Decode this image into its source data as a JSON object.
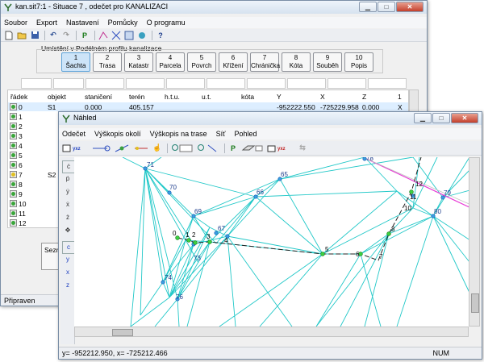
{
  "main_window": {
    "title": "kan.sit7:1 - Situace 7 , odečet pro KANALIZACI",
    "menu": [
      "Soubor",
      "Export",
      "Nastavení",
      "Pomůcky",
      "O programu"
    ],
    "group_label": "Umístění v Podélném profilu kanalizace",
    "tabs": [
      {
        "num": "1",
        "label": "Šachta"
      },
      {
        "num": "2",
        "label": "Trasa"
      },
      {
        "num": "3",
        "label": "Katastr"
      },
      {
        "num": "4",
        "label": "Parcela"
      },
      {
        "num": "5",
        "label": "Povrch"
      },
      {
        "num": "6",
        "label": "Křížení"
      },
      {
        "num": "7",
        "label": "Chránička"
      },
      {
        "num": "8",
        "label": "Kóta"
      },
      {
        "num": "9",
        "label": "Souběh"
      },
      {
        "num": "10",
        "label": "Popis"
      }
    ],
    "columns": [
      "řádek",
      "objekt",
      "staničení",
      "terén",
      "h.t.u.",
      "u.t.",
      "kóta",
      "Y",
      "X",
      "Z",
      "1"
    ],
    "first_row": {
      "row": "0",
      "objekt": "S1",
      "stanice": "0.000",
      "teren": "405.157",
      "Y": "-952222.550",
      "X": "-725229.958",
      "Z": "0.000",
      "extra": "X"
    },
    "row_numbers": [
      "0",
      "1",
      "2",
      "3",
      "4",
      "5",
      "6",
      "7",
      "8",
      "9",
      "10",
      "11",
      "12"
    ],
    "row7_object": "S2",
    "side_button": "Sezn",
    "status": "Připraven"
  },
  "preview_window": {
    "title": "Náhled",
    "menu": [
      "Odečet",
      "Výškopis okolí",
      "Výškopis na trase",
      "Síť",
      "Pohled"
    ],
    "coords": "y= -952212.950, x= -725212.466",
    "num": "NUM"
  },
  "map": {
    "point_labels": [
      {
        "t": "71"
      },
      {
        "t": "70"
      },
      {
        "t": "65"
      },
      {
        "t": "66"
      },
      {
        "t": "69"
      },
      {
        "t": "67"
      },
      {
        "t": "73"
      },
      {
        "t": "74"
      },
      {
        "t": "76"
      },
      {
        "t": "0"
      },
      {
        "t": "1"
      },
      {
        "t": "2"
      },
      {
        "t": "3"
      },
      {
        "t": "4"
      },
      {
        "t": "5"
      },
      {
        "t": "6"
      },
      {
        "t": "7"
      },
      {
        "t": "8"
      },
      {
        "t": "10"
      },
      {
        "t": "11"
      },
      {
        "t": "12"
      },
      {
        "t": "79"
      },
      {
        "t": "80"
      },
      {
        "t": "78"
      }
    ]
  }
}
